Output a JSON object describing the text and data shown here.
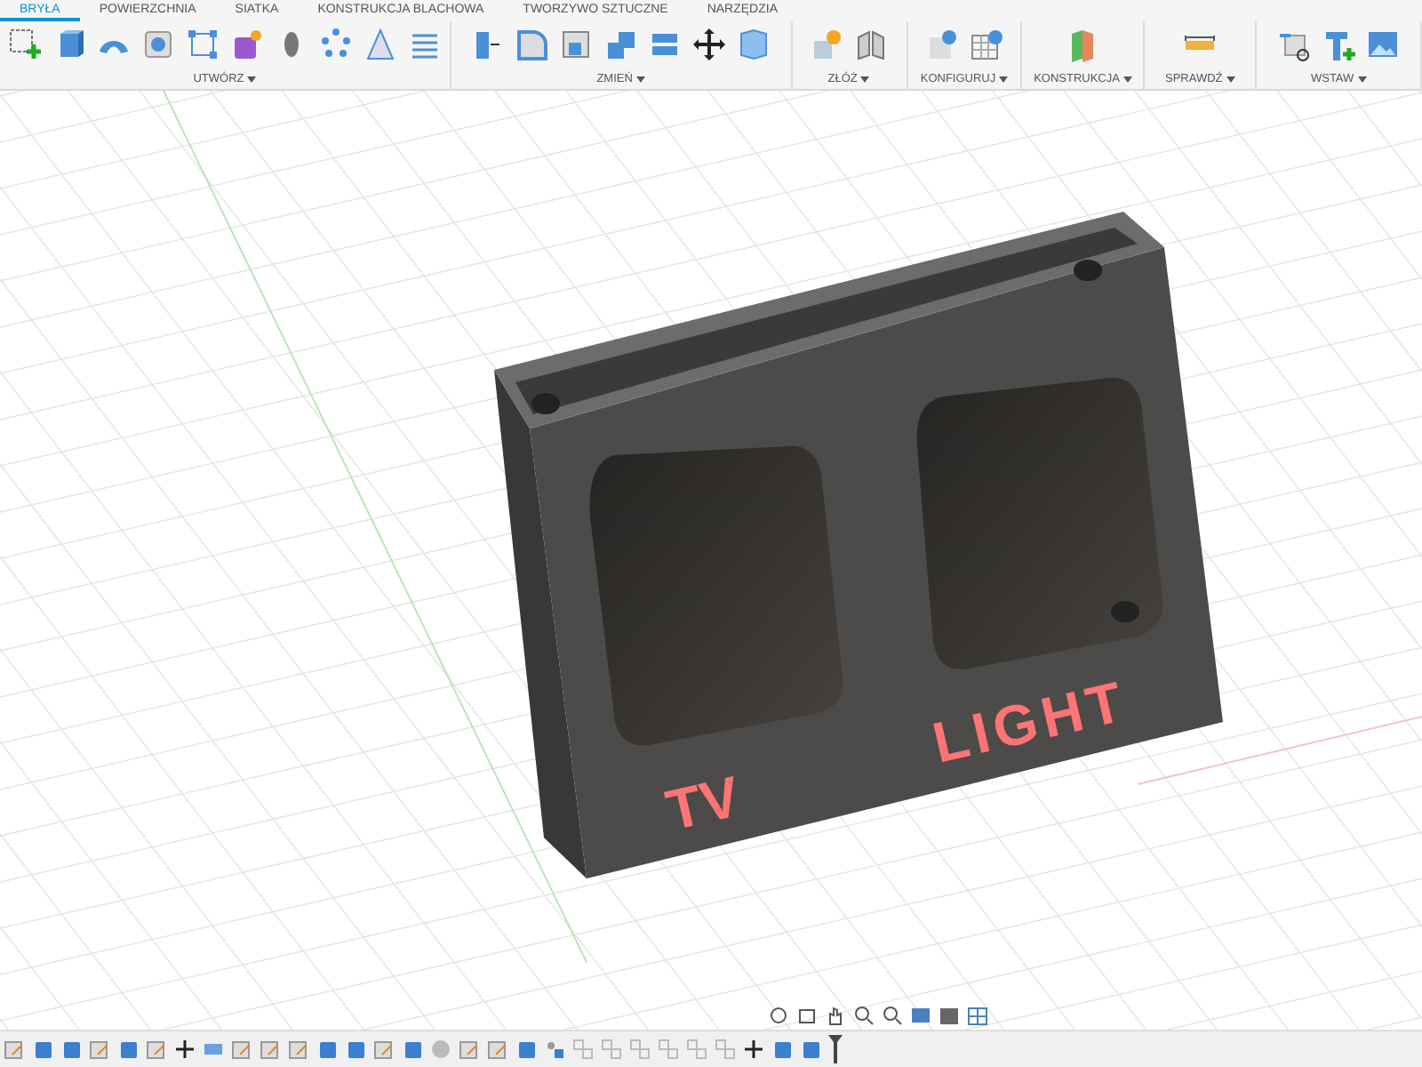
{
  "tabs": [
    {
      "label": "BRYŁA",
      "selected": true
    },
    {
      "label": "POWIERZCHNIA",
      "selected": false
    },
    {
      "label": "SIATKA",
      "selected": false
    },
    {
      "label": "KONSTRUKCJA BLACHOWA",
      "selected": false
    },
    {
      "label": "TWORZYWO SZTUCZNE",
      "selected": false
    },
    {
      "label": "NARZĘDZIA",
      "selected": false
    }
  ],
  "tool_groups": [
    {
      "label": "UTWÓRZ"
    },
    {
      "label": "ZMIEŃ"
    },
    {
      "label": "ZŁÓŻ"
    },
    {
      "label": "KONFIGURUJ"
    },
    {
      "label": "KONSTRUKCJA"
    },
    {
      "label": "SPRAWDŹ"
    },
    {
      "label": "WSTAW"
    }
  ],
  "model": {
    "labels": [
      "TV",
      "LIGHT"
    ]
  }
}
